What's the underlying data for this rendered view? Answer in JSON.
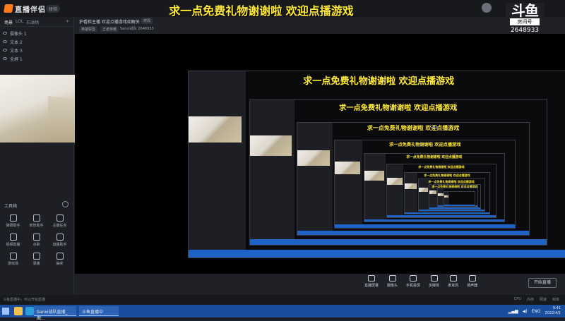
{
  "app": {
    "name": "直播伴侣",
    "badge": "体验"
  },
  "overlay": {
    "banner": "求一点免费礼物谢谢啦 欢迎点播游戏",
    "douyu_mark": "斗鱼",
    "douyu_sub": "房间号",
    "room_number": "2648933"
  },
  "left_panel": {
    "tabs": [
      "场景",
      "LOL",
      "石油场"
    ],
    "sources": [
      {
        "label": "摄像头 1"
      },
      {
        "label": "文本 2"
      },
      {
        "label": "文本 3"
      },
      {
        "label": "全屏 1"
      }
    ],
    "toolbox_title": "工具箱",
    "tools": [
      {
        "label": "弹幕助手",
        "icon": "danmaku-icon"
      },
      {
        "label": "房管助手",
        "icon": "manager-icon"
      },
      {
        "label": "主播任务",
        "icon": "task-icon"
      },
      {
        "label": "视频直播",
        "icon": "video-icon"
      },
      {
        "label": "点歌",
        "icon": "music-icon"
      },
      {
        "label": "直播助手",
        "icon": "assistant-icon"
      },
      {
        "label": "游戏场",
        "icon": "game-icon"
      },
      {
        "label": "录播",
        "icon": "record-icon"
      },
      {
        "label": "抽奖",
        "icon": "lottery-icon"
      }
    ]
  },
  "room": {
    "title": "护看斜主播 欢迎点播游戏如解关",
    "edit_label": "修改",
    "tags": [
      "英雄联盟",
      "王者荣耀"
    ],
    "stat": "Sanxi战队 2648933"
  },
  "bottom_toolbar": {
    "items": [
      {
        "label": "直播屏幕",
        "icon": "screen-icon"
      },
      {
        "label": "摄像头",
        "icon": "camera-icon"
      },
      {
        "label": "手机投屏",
        "icon": "phone-icon"
      },
      {
        "label": "多媒体",
        "icon": "media-icon"
      },
      {
        "label": "麦克风",
        "icon": "mic-icon"
      },
      {
        "label": "扬声器",
        "icon": "speaker-icon"
      }
    ],
    "start_label": "开始直播"
  },
  "status": {
    "left": "斗鱼直播中，可以开始直播",
    "right": [
      "CPU",
      "内存",
      "网速",
      "帧率"
    ]
  },
  "taskbar": {
    "tasks": [
      "Sanxi战队直播_图...",
      "斗鱼直播中"
    ],
    "lang": "ENG",
    "time": "9:41",
    "date": "2022/4/1"
  }
}
